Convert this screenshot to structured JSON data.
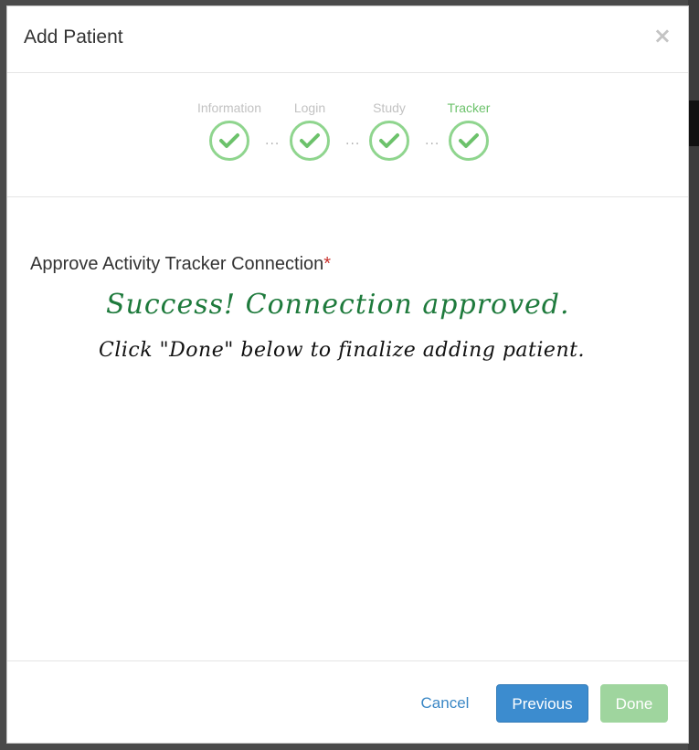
{
  "modal": {
    "title": "Add Patient",
    "close_glyph": "×"
  },
  "stepper": {
    "steps": [
      {
        "label": "Information",
        "state": "complete"
      },
      {
        "label": "Login",
        "state": "complete"
      },
      {
        "label": "Study",
        "state": "complete"
      },
      {
        "label": "Tracker",
        "state": "active-complete"
      }
    ],
    "connector": "···"
  },
  "body": {
    "field_label": "Approve Activity Tracker Connection",
    "required_marker": "*",
    "success_message": "Success! Connection approved.",
    "instruction_message": "Click \"Done\" below to finalize adding patient."
  },
  "footer": {
    "cancel_label": "Cancel",
    "previous_label": "Previous",
    "done_label": "Done"
  },
  "colors": {
    "accent_green": "#6cc26b",
    "primary_blue": "#3c8ccf",
    "success_text": "#1e7a3c"
  },
  "icons": {
    "close": "close-icon",
    "check": "checkmark-icon"
  }
}
